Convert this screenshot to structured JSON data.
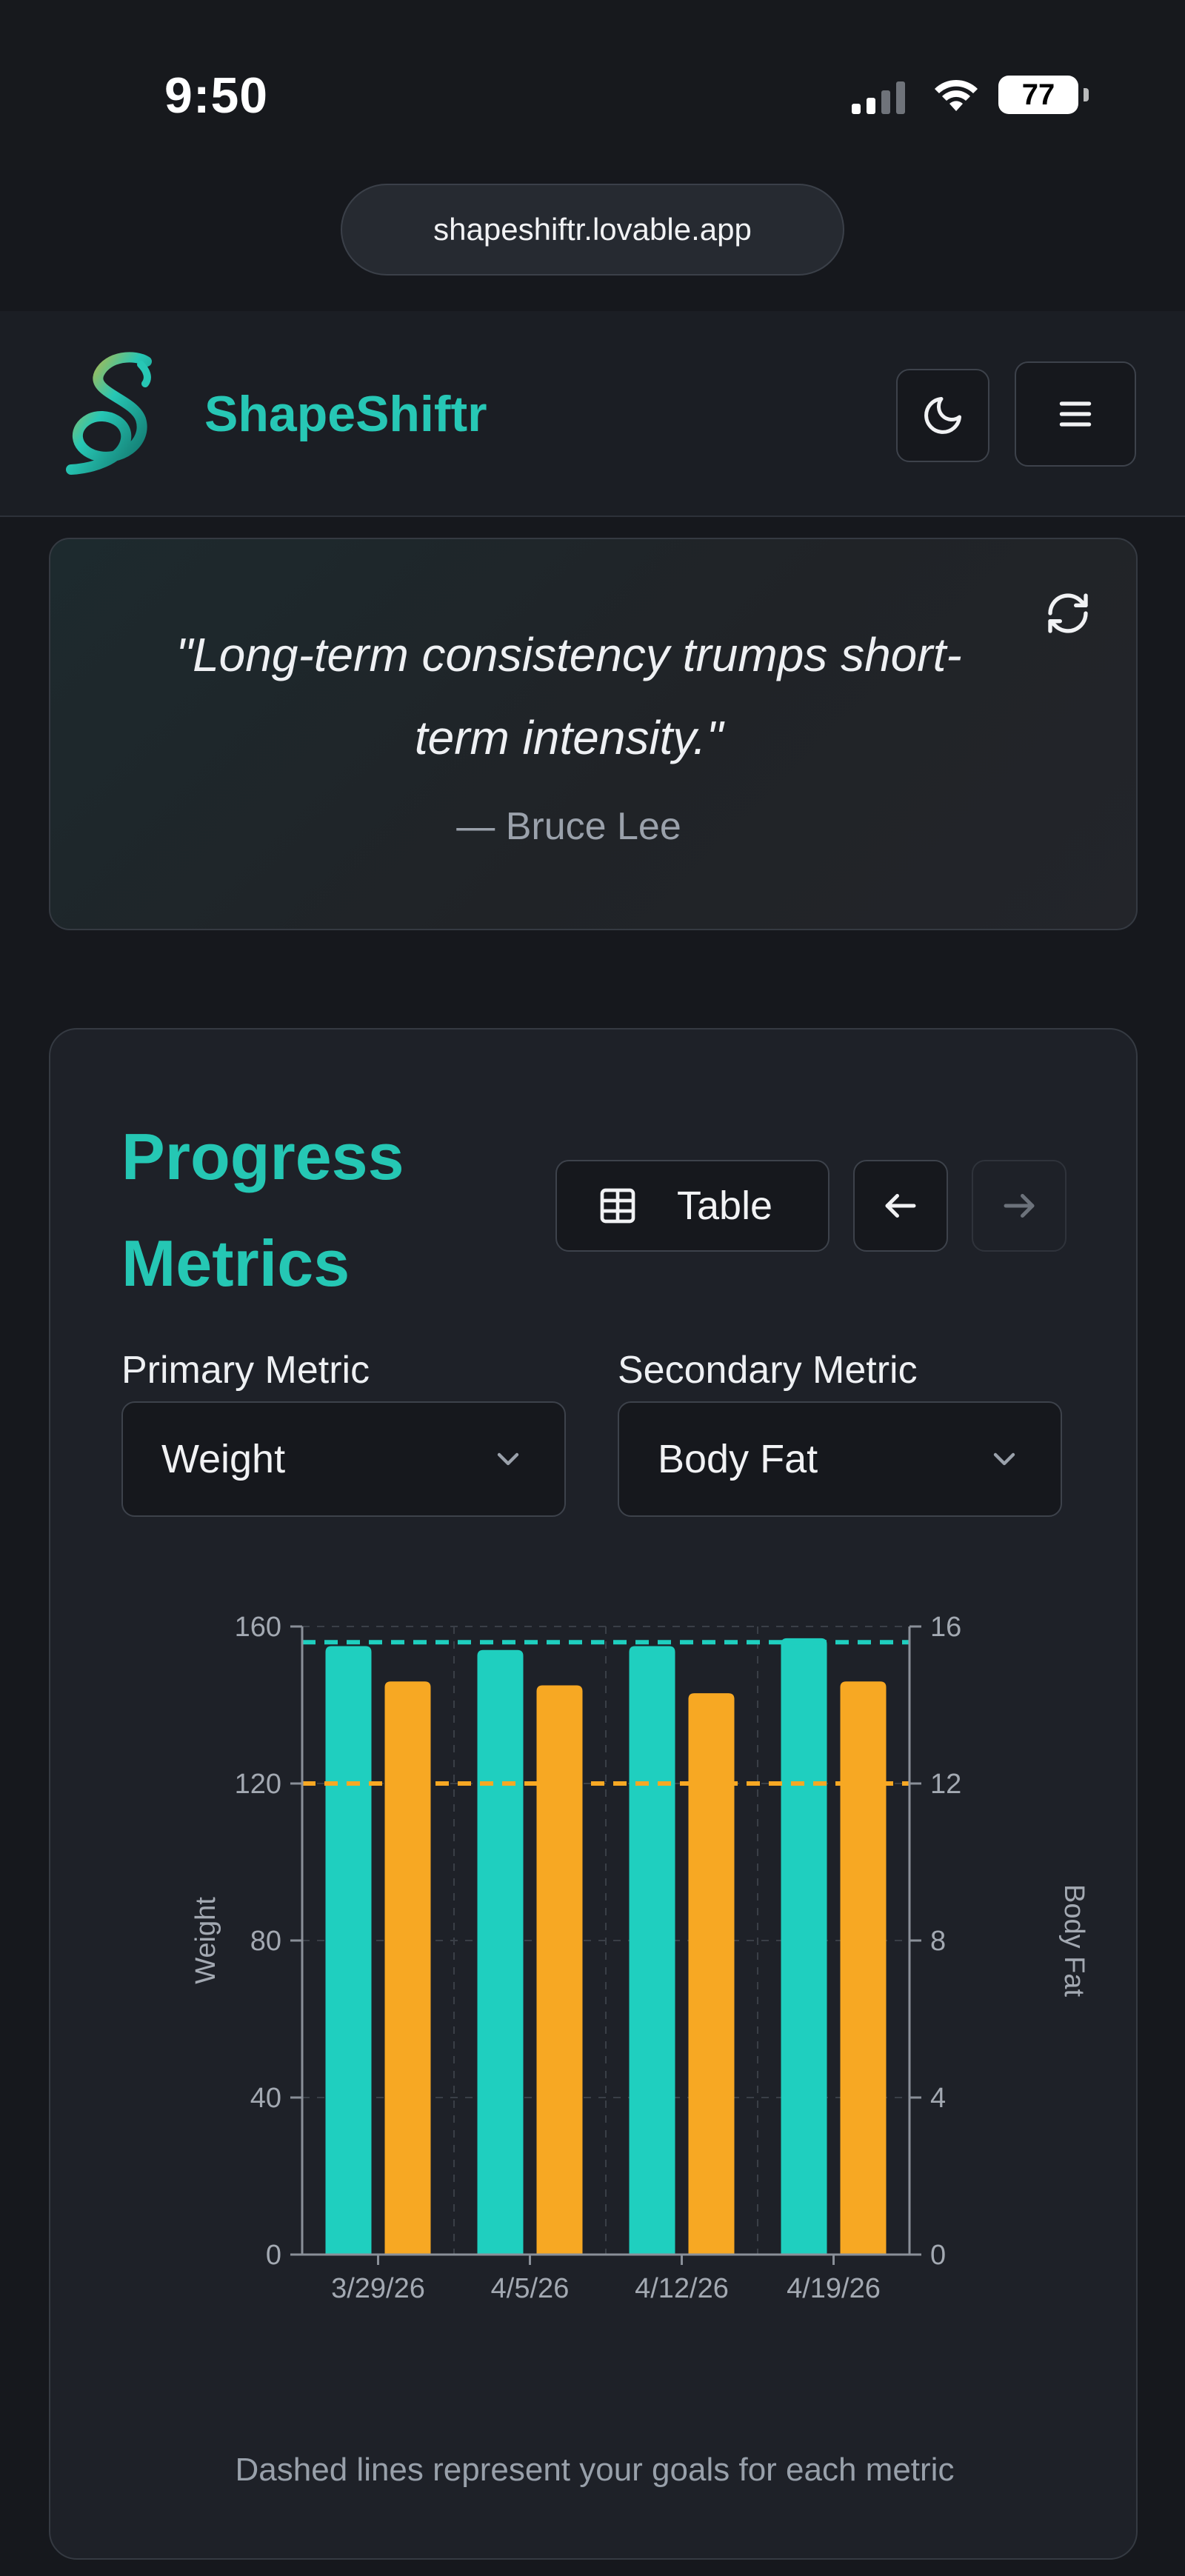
{
  "status_bar": {
    "time": "9:50",
    "battery": "77"
  },
  "browser": {
    "url": "shapeshiftr.lovable.app"
  },
  "header": {
    "brand": "ShapeShiftr"
  },
  "quote": {
    "text": "\"Long-term consistency trumps short-term intensity.\"",
    "author": "— Bruce Lee"
  },
  "metrics": {
    "title": "Progress Metrics",
    "table_label": "Table",
    "primary_label": "Primary Metric",
    "primary_value": "Weight",
    "secondary_label": "Secondary Metric",
    "secondary_value": "Body Fat",
    "note": "Dashed lines represent your goals for each metric"
  },
  "colors": {
    "accent": "#27c7b5",
    "primary_series": "#1fcfbf",
    "secondary_series": "#f7a823",
    "background": "#16181d"
  },
  "icons": [
    "signal-icon",
    "wifi-icon",
    "moon-icon",
    "menu-icon",
    "refresh-icon",
    "table-icon",
    "arrow-left-icon",
    "arrow-right-icon",
    "chevron-down-icon"
  ],
  "chart_data": {
    "type": "bar",
    "categories": [
      "3/29/26",
      "4/5/26",
      "4/12/26",
      "4/19/26"
    ],
    "series": [
      {
        "name": "Weight",
        "axis": "left",
        "values": [
          155,
          154,
          155,
          157
        ]
      },
      {
        "name": "Body Fat",
        "axis": "right",
        "values": [
          14.6,
          14.5,
          14.3,
          14.6
        ]
      }
    ],
    "goals": {
      "left": 156,
      "right": 12
    },
    "ylabel": "Weight",
    "y2label": "Body Fat",
    "ylim": [
      0,
      160
    ],
    "y2lim": [
      0,
      16
    ],
    "yticks": [
      "0",
      "40",
      "80",
      "120",
      "160"
    ],
    "y2ticks": [
      "0",
      "4",
      "8",
      "12",
      "16"
    ],
    "grid": true
  }
}
